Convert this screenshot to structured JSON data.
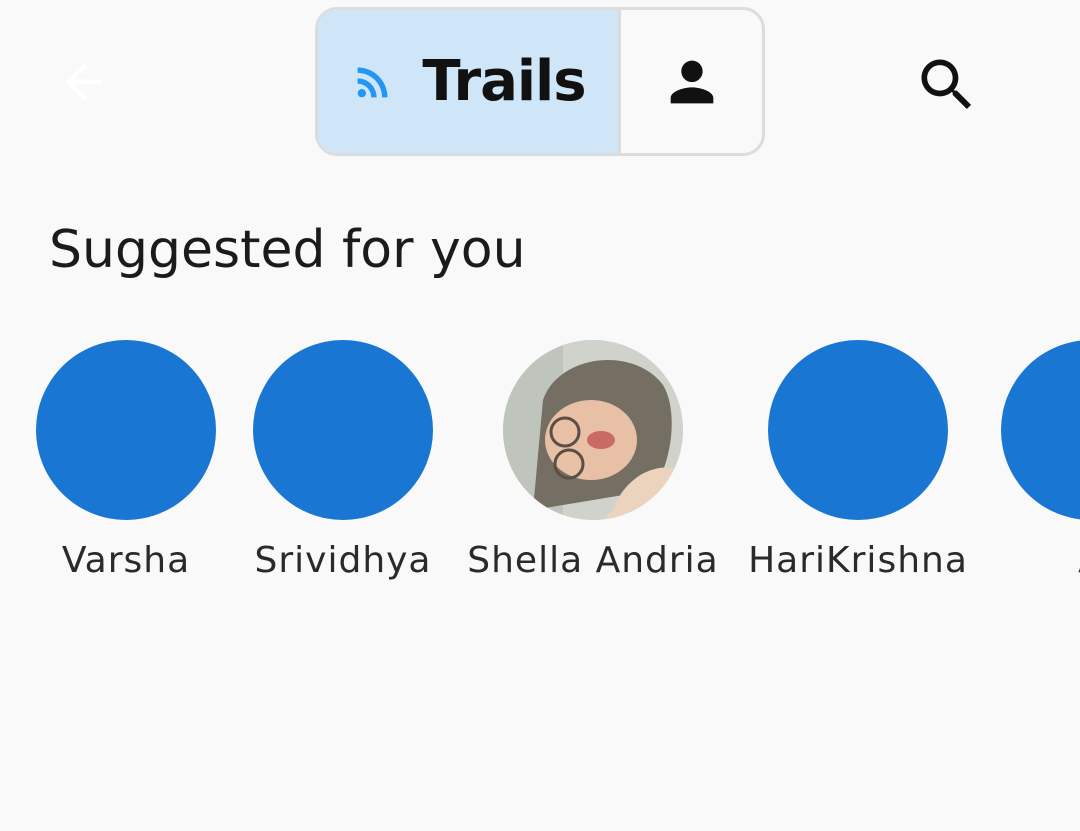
{
  "header": {
    "back_icon": "arrow-back-icon",
    "toggle": {
      "trails_label": "Trails",
      "trails_icon": "rss-feed-icon",
      "profile_icon": "person-icon"
    },
    "search_icon": "search-icon"
  },
  "suggestions": {
    "title": "Suggested for you",
    "people": [
      {
        "name": "Varsha",
        "avatar": "blue-circle"
      },
      {
        "name": "Srividhya",
        "avatar": "blue-circle"
      },
      {
        "name": "Shella Andria",
        "avatar": "photo"
      },
      {
        "name": "HariKrishna",
        "avatar": "blue-circle"
      },
      {
        "name": "A",
        "avatar": "blue-circle"
      }
    ]
  },
  "colors": {
    "background": "#f9f9f9",
    "avatar_blue": "#1976d2",
    "selected_segment": "#cfe5f8",
    "feed_icon_blue": "#2196f3",
    "text_dark": "#1b1b1b"
  }
}
